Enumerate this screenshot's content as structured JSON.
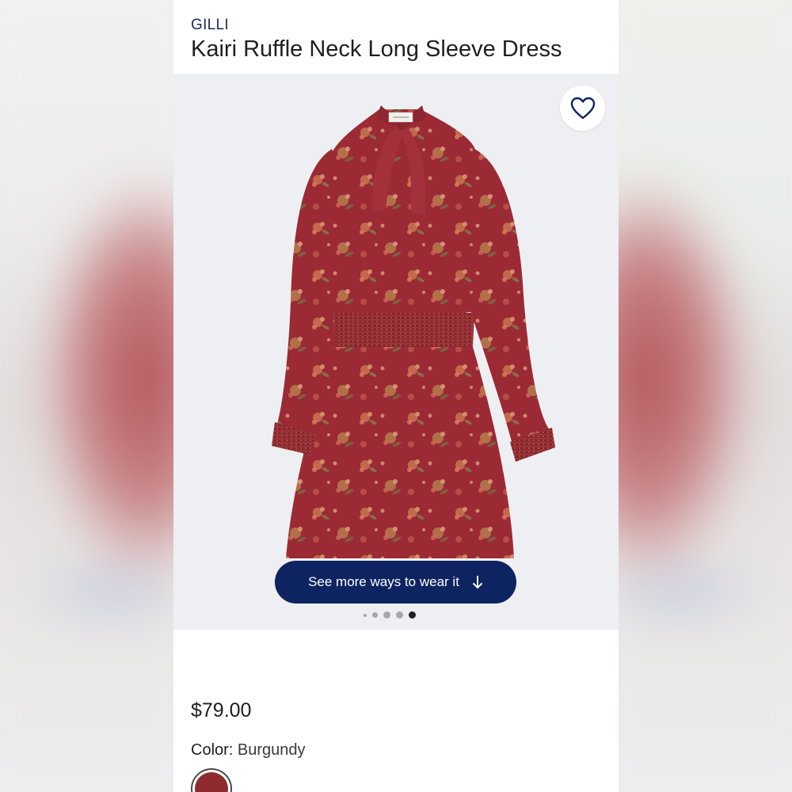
{
  "product": {
    "brand": "GILLI",
    "title": "Kairi Ruffle Neck Long Sleeve Dress",
    "price": "$79.00",
    "color_label": "Color:",
    "color_value": "Burgundy",
    "swatch_color": "#8e2b2f"
  },
  "gallery": {
    "cta_label": "See more ways to wear it",
    "cta_icon": "arrow-down-icon",
    "favorite_icon": "heart-outline-icon",
    "image_subject": "burgundy-floral-dress",
    "dot_count": 5,
    "active_dot": 4
  },
  "colors": {
    "accent": "#0e2461",
    "dress": "#9b2a34"
  }
}
